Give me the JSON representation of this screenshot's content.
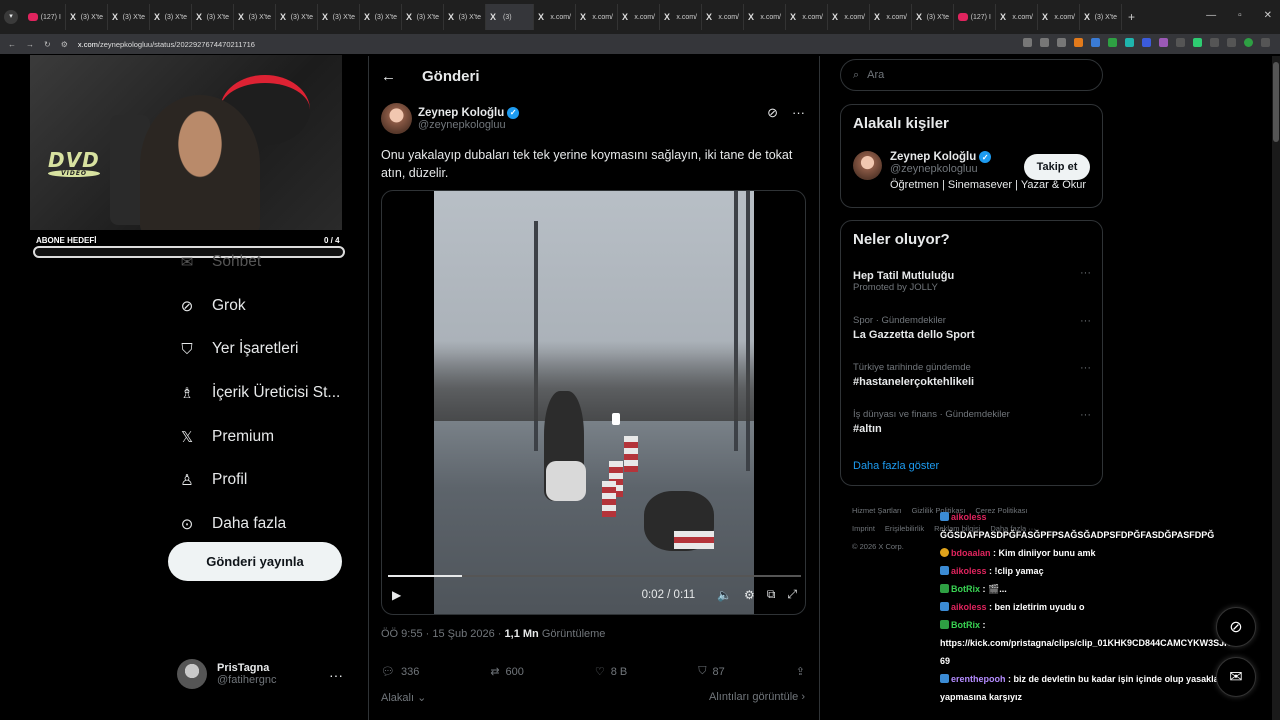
{
  "browser": {
    "tabs": [
      {
        "label": "(127) Ⅰ",
        "type": "yt"
      },
      {
        "label": "(3) X'te",
        "type": "x"
      },
      {
        "label": "(3) X'te",
        "type": "x"
      },
      {
        "label": "(3) X'te",
        "type": "x"
      },
      {
        "label": "(3) X'te",
        "type": "x"
      },
      {
        "label": "(3) X'te",
        "type": "x"
      },
      {
        "label": "(3) X'te",
        "type": "x"
      },
      {
        "label": "(3) X'te",
        "type": "x"
      },
      {
        "label": "(3) X'te",
        "type": "x"
      },
      {
        "label": "(3) X'te",
        "type": "x"
      },
      {
        "label": "(3) X'te",
        "type": "x"
      },
      {
        "label": "(3)",
        "type": "x",
        "active": true
      },
      {
        "label": "x.com/",
        "type": "x"
      },
      {
        "label": "x.com/",
        "type": "x"
      },
      {
        "label": "x.com/",
        "type": "x"
      },
      {
        "label": "x.com/",
        "type": "x"
      },
      {
        "label": "x.com/",
        "type": "x"
      },
      {
        "label": "x.com/",
        "type": "x"
      },
      {
        "label": "x.com/",
        "type": "x"
      },
      {
        "label": "x.com/",
        "type": "x"
      },
      {
        "label": "x.com/",
        "type": "x"
      },
      {
        "label": "(3) X'te",
        "type": "x"
      },
      {
        "label": "(127) Ⅰ",
        "type": "yt"
      },
      {
        "label": "x.com/",
        "type": "x"
      },
      {
        "label": "x.com/",
        "type": "x"
      },
      {
        "label": "(3) X'te",
        "type": "x"
      }
    ],
    "url_host": "x.com",
    "url_path": "/zeynepkologluu/status/2022927674470211716"
  },
  "stream": {
    "goal_label": "ABONE HEDEFİ",
    "goal_count": "0 / 4",
    "dvd_text": "DVD",
    "dvd_sub": "VIDEO"
  },
  "nav": {
    "items": [
      {
        "label": "Sohbet",
        "icon": "mail-icon",
        "glyph": "✉"
      },
      {
        "label": "Grok",
        "icon": "grok-icon",
        "glyph": "⊘"
      },
      {
        "label": "Yer İşaretleri",
        "icon": "bookmark-icon",
        "glyph": "⛉"
      },
      {
        "label": "İçerik Üreticisi St...",
        "icon": "flask-icon",
        "glyph": "♗"
      },
      {
        "label": "Premium",
        "icon": "x-logo-icon",
        "glyph": "𝕏"
      },
      {
        "label": "Profil",
        "icon": "person-icon",
        "glyph": "♙"
      },
      {
        "label": "Daha fazla",
        "icon": "more-circle-icon",
        "glyph": "⊙"
      }
    ],
    "post_button": "Gönderi yayınla",
    "account_name": "PrisTagna",
    "account_handle": "@fatihergnc"
  },
  "main": {
    "header_title": "Gönderi",
    "author_name": "Zeynep Koloğlu",
    "author_handle": "@zeynepkologluu",
    "tweet_text": "Onu yakalayıp dubaları tek tek yerine koymasını sağlayın, iki tane de tokat atın, düzelir.",
    "video_time": "0:02 / 0:11",
    "video_progress": 0.18,
    "timestamp": "ÖÖ 9:55 · 15 Şub 2026 · ",
    "views_count": "1,1 Mn",
    "views_label": " Görüntüleme",
    "replies": "336",
    "reposts": "600",
    "likes": "8 B",
    "bookmarks": "87",
    "related_label": "Alakalı",
    "quotes_label": "Alıntıları görüntüle"
  },
  "right": {
    "search_placeholder": "Ara",
    "relevant_title": "Alakalı kişiler",
    "person_name": "Zeynep Koloğlu",
    "person_handle": "@zeynepkologluu",
    "person_bio": "Öğretmen | Sinemasever | Yazar & Okur",
    "follow_label": "Takip et",
    "trends_title": "Neler oluyor?",
    "trends": [
      {
        "context": "Promoted by JOLLY",
        "title": "Hep Tatil Mutluluğu"
      },
      {
        "context": "Spor · Gündemdekiler",
        "title": "La Gazzetta dello Sport"
      },
      {
        "context": "Türkiye tarihinde gündemde",
        "title": "#hastanelerçoktehlikeli"
      },
      {
        "context": "İş dünyası ve finans · Gündemdekiler",
        "title": "#altın"
      }
    ],
    "show_more": "Daha fazla göster",
    "footer": [
      "Hizmet Şartları",
      "Gizlilik Politikası",
      "Çerez Politikası",
      "Imprint",
      "Erişilebilirlik",
      "Reklam bilgisi",
      "Daha fazla ···",
      "© 2026 X Corp."
    ]
  },
  "chat": [
    {
      "user": "aikoless",
      "text": ""
    },
    {
      "user": "",
      "text": "ĞĞSDAFPASDPĞFASĞPFPSAĞSĞADPSFDPĞFASDĞPASFDPĞ"
    },
    {
      "user": "bdoaalan",
      "text": ": Kim diniiyor bunu amk"
    },
    {
      "user": "aikoless",
      "text": ": !clip yamaç"
    },
    {
      "user": "BotRix",
      "text": ": 🎬..."
    },
    {
      "user": "aikoless",
      "text": ": ben izletirim uyudu o"
    },
    {
      "user": "BotRix",
      "text": ":"
    },
    {
      "user": "",
      "text": "https://kick.com/pristagna/clips/clip_01KHK9CD844CAMCYKW3SJH60"
    },
    {
      "user": "",
      "text": "69"
    },
    {
      "user": "erenthepooh",
      "text": ": biz de devletin bu kadar işin içinde olup yasaklama"
    },
    {
      "user": "",
      "text": "yapmasına karşıyız"
    }
  ],
  "colors": {
    "accent": "#1d9bf0",
    "bg": "#000000",
    "border": "#2f3336"
  }
}
